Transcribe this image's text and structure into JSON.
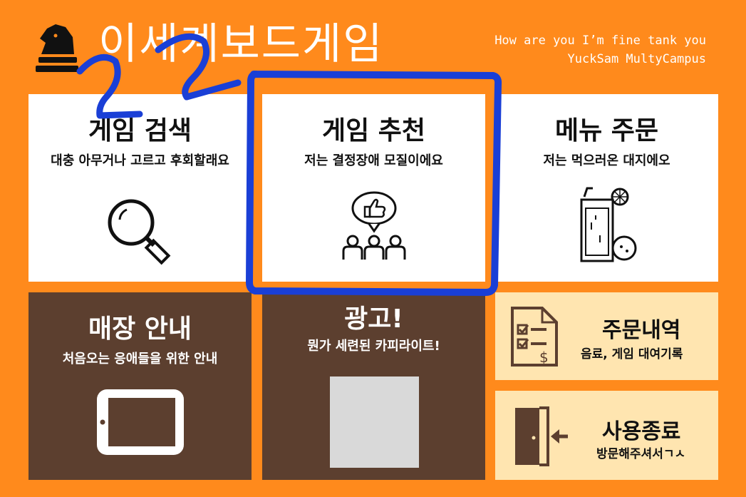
{
  "header": {
    "title": "이세계보드게임",
    "tagline_line1": "How are you I’m fine tank you",
    "tagline_line2": "YuckSam MultyCampus",
    "logo_icon": "chess-knight-icon"
  },
  "annotation": {
    "scribble_text": "22",
    "highlight_color": "#1a3fd6"
  },
  "cards": {
    "search": {
      "title": "게임 검색",
      "subtitle": "대충 아무거나 고르고 후회할래요",
      "icon": "magnifier-icon"
    },
    "recommend": {
      "title": "게임 추천",
      "subtitle": "저는 결정장애 모질이에요",
      "icon": "thumbs-up-group-icon"
    },
    "menu": {
      "title": "메뉴 주문",
      "subtitle": "저는 먹으러온 대지에오",
      "icon": "drink-icon"
    },
    "store": {
      "title": "매장 안내",
      "subtitle": "처음오는 응애들을 위한 안내",
      "icon": "tablet-icon"
    },
    "ad": {
      "title": "광고!",
      "subtitle": "뭔가 세련된 카피라이트!"
    },
    "orders": {
      "title": "주문내역",
      "subtitle": "음료, 게임 대여기록",
      "icon": "checklist-invoice-icon"
    },
    "exit": {
      "title": "사용종료",
      "subtitle": "방문해주셔서ㄱㅅ",
      "icon": "door-exit-icon"
    }
  },
  "colors": {
    "background": "#ff8a1c",
    "brown": "#5c3f2f",
    "cream": "#ffe5b0",
    "white": "#ffffff"
  }
}
